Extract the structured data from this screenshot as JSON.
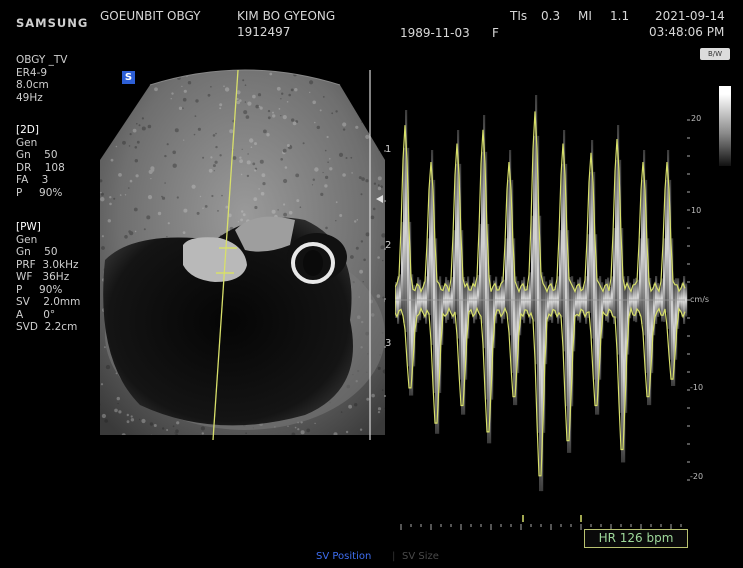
{
  "header": {
    "brand": "SAMSUNG",
    "institution": "GOEUNBIT OBGY",
    "patient_name": "KIM BO GYEONG",
    "patient_id": "1912497",
    "birth_date": "1989-11-03",
    "sex": "F",
    "tis_label": "TIs",
    "tis_value": "0.3",
    "mi_label": "MI",
    "mi_value": "1.1",
    "date": "2021-09-14",
    "time": "03:48:06 PM"
  },
  "probe": {
    "preset": "OBGY _TV",
    "transducer": "ER4-9",
    "depth": "8.0cm",
    "frame_rate": "49Hz"
  },
  "mode_2d": {
    "title": "[2D]",
    "rows": [
      "Gen",
      "Gn    50",
      "DR    108",
      "FA    3",
      "P     90%"
    ]
  },
  "mode_pw": {
    "title": "[PW]",
    "rows": [
      "Gen",
      "Gn    50",
      "PRF  3.0kHz",
      "WF   36Hz",
      "P     90%",
      "SV    2.0mm",
      "A      0°",
      "SVD  2.2cm"
    ]
  },
  "depth_scale": [
    "1",
    "2",
    "3"
  ],
  "velocity_scale": {
    "labels": [
      "20",
      "10",
      "cm/s",
      "-10",
      "-20"
    ]
  },
  "badges": {
    "s_badge": "S",
    "bw_icon": "B/W"
  },
  "readout": {
    "heart_rate": "HR  126 bpm"
  },
  "bottom_tabs": {
    "sv_position": "SV Position",
    "sv_size": "SV Size"
  },
  "colors": {
    "background": "#000000",
    "trace": "#d8e06a",
    "active_tab": "#3f6ef0",
    "inactive_tab": "#4a4a4a",
    "hr_text": "#9ed89a"
  }
}
